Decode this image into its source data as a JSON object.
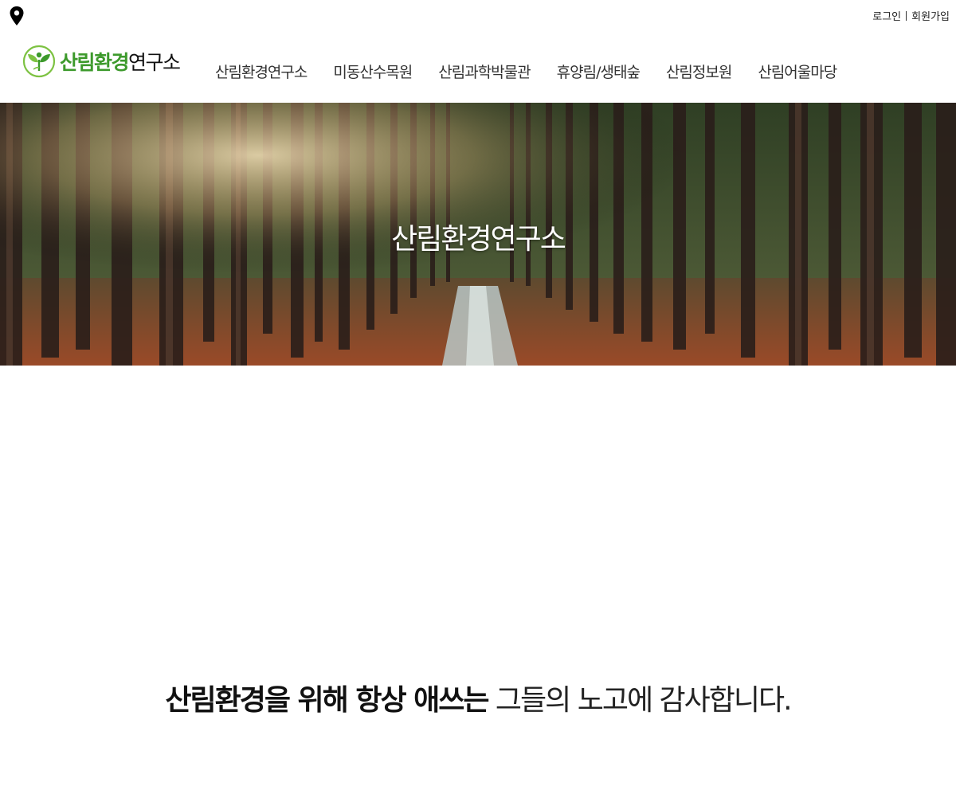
{
  "topbar": {
    "location_icon": "map-pin-icon",
    "login_label": "로그인",
    "signup_label": "회원가입"
  },
  "header": {
    "logo_icon": "leaf-sprout-icon",
    "logo_text_green": "산림환경",
    "logo_text_black": "연구소"
  },
  "nav": {
    "items": [
      {
        "label": "산림환경연구소"
      },
      {
        "label": "미동산수목원"
      },
      {
        "label": "산림과학박물관"
      },
      {
        "label": "휴양림/생태숲"
      },
      {
        "label": "산림정보원"
      },
      {
        "label": "산림어울마당"
      }
    ]
  },
  "hero": {
    "title": "산림환경연구소"
  },
  "tagline": {
    "bold": "산림환경을 위해 항상 애쓰는",
    "light": "그들의 노고에 감사합니다."
  },
  "colors": {
    "brand_green": "#3d9a2c",
    "leaf_light_green": "#7dc242",
    "text_dark": "#111111"
  }
}
